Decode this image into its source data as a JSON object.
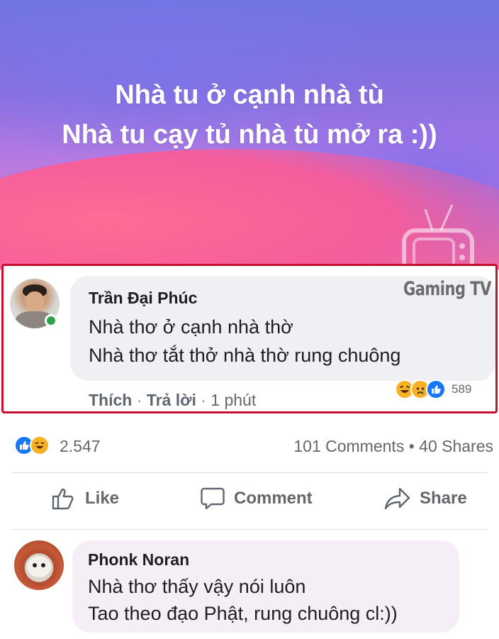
{
  "post": {
    "text_lines": [
      "Nhà tu ở cạnh nhà tù",
      "Nhà tu cạy tủ nhà tù mở ra :))"
    ],
    "gradient_colors": [
      "#6f74e2",
      "#b77be2",
      "#e56fa8"
    ],
    "watermark": "Gaming TV"
  },
  "highlight_comment": {
    "author": "Trần Đại Phúc",
    "lines": [
      "Nhà thơ ở cạnh nhà thờ",
      "Nhà thơ tắt thở nhà thờ rung chuông"
    ],
    "actions": {
      "like": "Thích",
      "reply": "Trả lời",
      "time": "1 phút"
    },
    "reaction_icons": [
      "haha-icon",
      "sad-icon",
      "like-icon"
    ],
    "reaction_count": "589",
    "online": true,
    "border_color": "#c8102e"
  },
  "stats": {
    "reaction_icons": [
      "like-icon",
      "haha-icon"
    ],
    "reaction_total": "2.547",
    "comments_shares": "101 Comments • 40 Shares"
  },
  "action_bar": {
    "like": "Like",
    "comment": "Comment",
    "share": "Share"
  },
  "second_comment": {
    "author": "Phonk Noran",
    "lines": [
      "Nhà thơ thấy vậy nói luôn",
      "Tao theo đạo Phật, rung chuông cl:))"
    ]
  }
}
